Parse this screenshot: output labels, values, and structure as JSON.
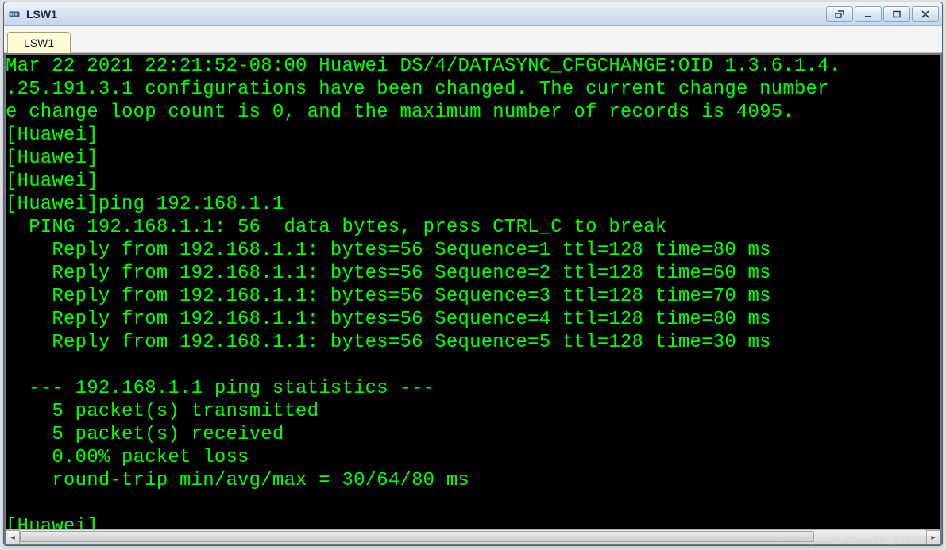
{
  "window": {
    "title": "LSW1",
    "tab_label": "LSW1"
  },
  "terminal": {
    "lines": [
      "Mar 22 2021 22:21:52-08:00 Huawei DS/4/DATASYNC_CFGCHANGE:OID 1.3.6.1.4.",
      ".25.191.3.1 configurations have been changed. The current change number",
      "e change loop count is 0, and the maximum number of records is 4095.",
      "[Huawei]",
      "[Huawei]",
      "[Huawei]",
      "[Huawei]ping 192.168.1.1",
      "  PING 192.168.1.1: 56  data bytes, press CTRL_C to break",
      "    Reply from 192.168.1.1: bytes=56 Sequence=1 ttl=128 time=80 ms",
      "    Reply from 192.168.1.1: bytes=56 Sequence=2 ttl=128 time=60 ms",
      "    Reply from 192.168.1.1: bytes=56 Sequence=3 ttl=128 time=70 ms",
      "    Reply from 192.168.1.1: bytes=56 Sequence=4 ttl=128 time=80 ms",
      "    Reply from 192.168.1.1: bytes=56 Sequence=5 ttl=128 time=30 ms",
      "",
      "  --- 192.168.1.1 ping statistics ---",
      "    5 packet(s) transmitted",
      "    5 packet(s) received",
      "    0.00% packet loss",
      "    round-trip min/avg/max = 30/64/80 ms",
      "",
      "[Huawei]"
    ]
  },
  "watermark": "https://blog.csdn.net/weixin_51048253"
}
